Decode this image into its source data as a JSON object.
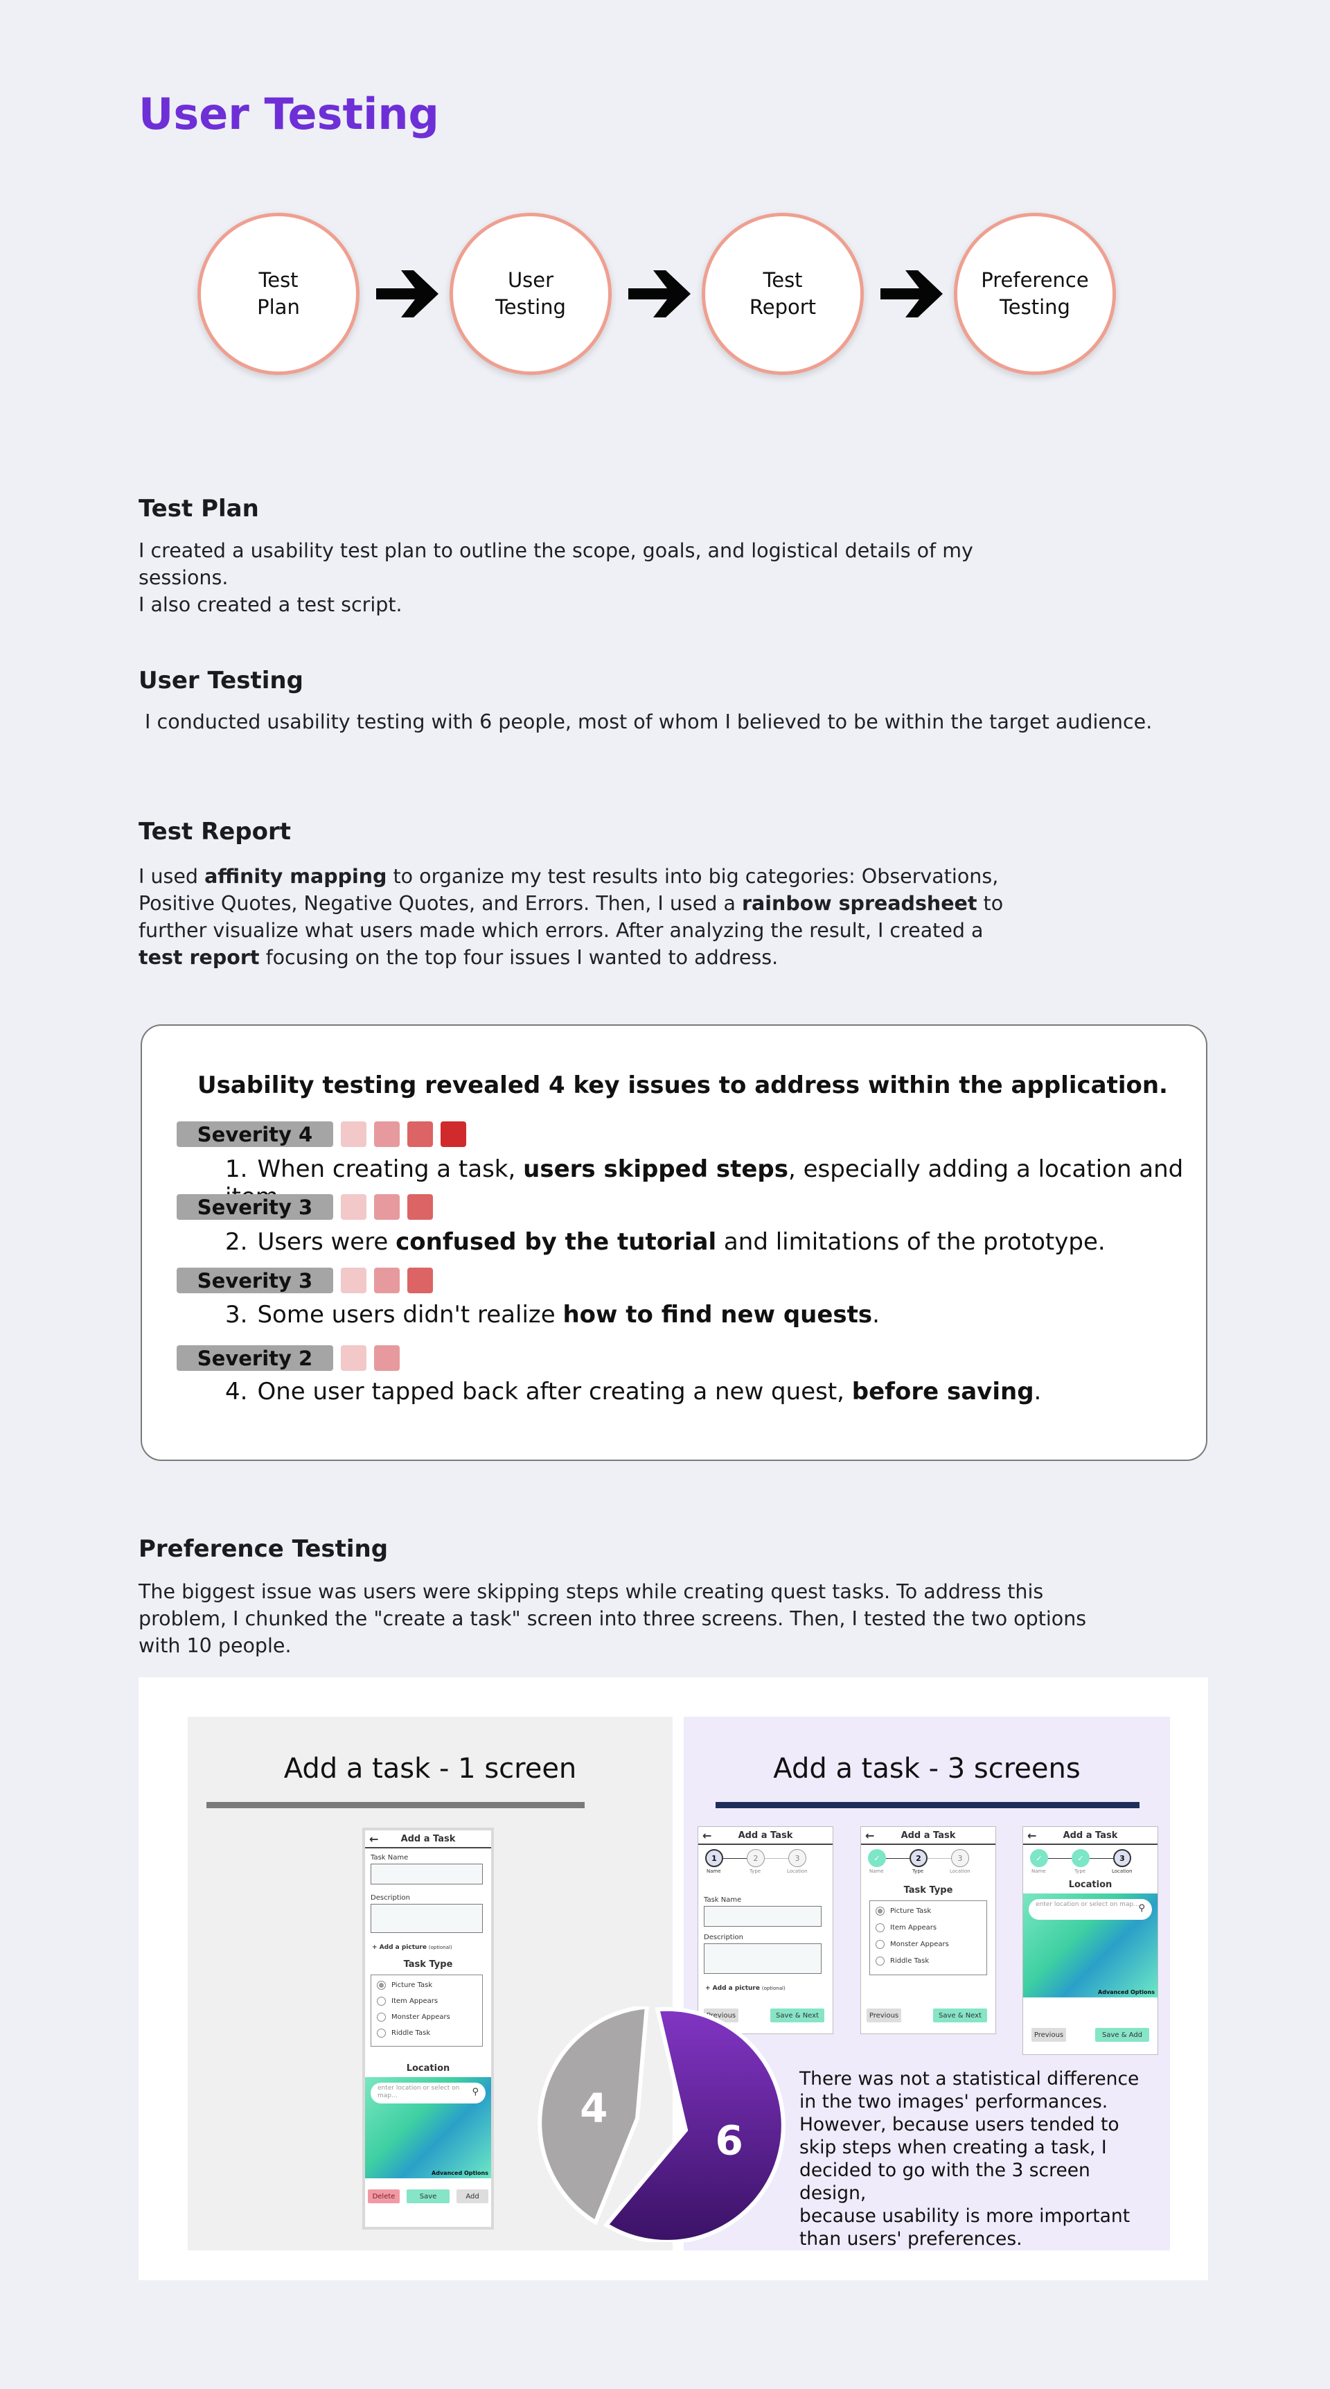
{
  "page": {
    "title": "User Testing"
  },
  "flow": {
    "steps": [
      "Test\nPlan",
      "User\nTesting",
      "Test\nReport",
      "Preference\nTesting"
    ]
  },
  "sections": {
    "test_plan": {
      "title": "Test Plan",
      "line1": "I created a usability test plan to outline the scope, goals, and logistical details of my sessions.",
      "line2": "I also created a test script."
    },
    "user_testing": {
      "title": "User Testing",
      "body": " I conducted usability testing with 6 people, most of whom I believed to be within the target audience."
    },
    "test_report": {
      "title": "Test Report",
      "p1": "I used ",
      "b1": "affinity mapping",
      "p2": " to organize my test results into big categories: Observations, Positive Quotes, Negative Quotes, and Errors. Then, I used a ",
      "b2": "rainbow spreadsheet",
      "p3": " to further visualize what users made which errors. After analyzing the result, I created a ",
      "b3": "test report",
      "p4": " focusing on the top four issues I wanted to address."
    },
    "preference_testing": {
      "title": "Preference Testing",
      "body": "The biggest issue was users were skipping steps while creating quest tasks. To address this problem, I chunked the \"create a task\" screen into three screens. Then, I tested the two options with 10 people."
    }
  },
  "issues_card": {
    "heading": "Usability testing revealed 4 key issues to address within the application.",
    "severity_colors": [
      "#f2c8c9",
      "#e79a9d",
      "#dc6464",
      "#d02a2d"
    ],
    "issues": [
      {
        "severity": "Severity 4",
        "level": 4,
        "num": "1.",
        "pre": "When creating a task, ",
        "bold": "users skipped steps",
        "post": ", especially adding a location and item."
      },
      {
        "severity": "Severity 3",
        "level": 3,
        "num": "2.",
        "pre": "Users were ",
        "bold": "confused by the tutorial",
        "post": " and limitations of the prototype."
      },
      {
        "severity": "Severity 3",
        "level": 3,
        "num": "3.",
        "pre": "Some users didn't realize ",
        "bold": "how to find new quests",
        "post": "."
      },
      {
        "severity": "Severity 2",
        "level": 2,
        "num": "4.",
        "pre": "One user tapped back after creating a new quest, ",
        "bold": "before saving",
        "post": "."
      }
    ]
  },
  "preference": {
    "left_title": "Add a task - 1 screen",
    "right_title": "Add a task - 3 screens",
    "colors": {
      "left_rule": "#7b7b7b",
      "right_rule": "#1f2f5a"
    },
    "mock": {
      "bar_title": "Add a Task",
      "back": "←",
      "task_name": "Task Name",
      "description": "Description",
      "add_picture": "+ Add a picture",
      "optional": "(optional)",
      "task_type": "Task Type",
      "types": [
        "Picture Task",
        "Item Appears",
        "Monster Appears",
        "Riddle Task"
      ],
      "location": "Location",
      "map_placeholder": "enter location or select on map...",
      "map_tag": "Advanced Options",
      "delete": "Delete",
      "save": "Save",
      "add": "Add",
      "previous": "Previous",
      "save_next": "Save & Next",
      "save_add": "Save & Add",
      "steps": [
        "1",
        "2",
        "3"
      ],
      "step_names": [
        "Name",
        "Type",
        "Location"
      ],
      "check": "✓",
      "search_icon": "⚲"
    },
    "pie": {
      "type": "pie",
      "values": [
        4,
        6
      ],
      "labels": [
        "4",
        "6"
      ],
      "colors": [
        "#a9a7a8",
        "#5d2296"
      ]
    },
    "conclusion": "There was not a statistical difference\nin the two images' performances.\nHowever, because users tended to\nskip steps when creating a task, I\ndecided to go with the 3 screen design,\nbecause usability is more important\nthan users' preferences."
  }
}
